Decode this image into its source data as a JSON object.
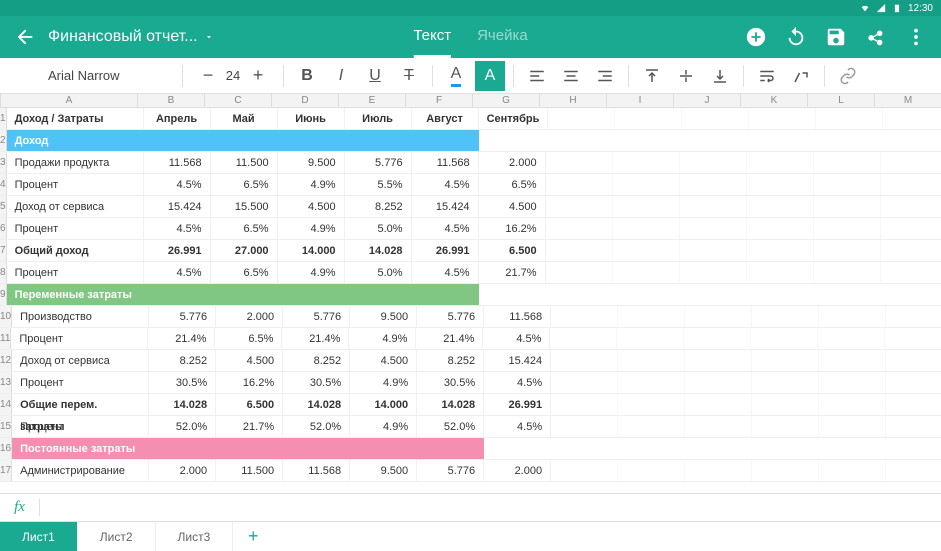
{
  "status": {
    "time": "12:30"
  },
  "header": {
    "title": "Финансовый отчет...",
    "tabs": [
      "Текст",
      "Ячейка"
    ],
    "active_tab": 0
  },
  "toolbar": {
    "font": "Arial Narrow",
    "font_size": "24"
  },
  "columns": [
    "A",
    "B",
    "C",
    "D",
    "E",
    "F",
    "G",
    "H",
    "I",
    "J",
    "K",
    "L",
    "M"
  ],
  "data_cols": 6,
  "rows": [
    {
      "n": 1,
      "type": "hdr",
      "cells": [
        "Доход / Затраты",
        "Апрель",
        "Май",
        "Июнь",
        "Июль",
        "Август",
        "Сентябрь"
      ]
    },
    {
      "n": 2,
      "type": "sect blue",
      "cells": [
        "Доход",
        "",
        "",
        "",
        "",
        "",
        ""
      ]
    },
    {
      "n": 3,
      "type": "",
      "cells": [
        "Продажи продукта",
        "11.568",
        "11.500",
        "9.500",
        "5.776",
        "11.568",
        "2.000"
      ]
    },
    {
      "n": 4,
      "type": "",
      "cells": [
        "Процент",
        "4.5%",
        "6.5%",
        "4.9%",
        "5.5%",
        "4.5%",
        "6.5%"
      ]
    },
    {
      "n": 5,
      "type": "",
      "cells": [
        "Доход от сервиса",
        "15.424",
        "15.500",
        "4.500",
        "8.252",
        "15.424",
        "4.500"
      ]
    },
    {
      "n": 6,
      "type": "",
      "cells": [
        "Процент",
        "4.5%",
        "6.5%",
        "4.9%",
        "5.0%",
        "4.5%",
        "16.2%"
      ]
    },
    {
      "n": 7,
      "type": "bold",
      "cells": [
        "Общий доход",
        "26.991",
        "27.000",
        "14.000",
        "14.028",
        "26.991",
        "6.500"
      ]
    },
    {
      "n": 8,
      "type": "",
      "cells": [
        "Процент",
        "4.5%",
        "6.5%",
        "4.9%",
        "5.0%",
        "4.5%",
        "21.7%"
      ]
    },
    {
      "n": 9,
      "type": "sect green",
      "cells": [
        "Переменные затраты",
        "",
        "",
        "",
        "",
        "",
        ""
      ]
    },
    {
      "n": 10,
      "type": "",
      "cells": [
        "Производство",
        "5.776",
        "2.000",
        "5.776",
        "9.500",
        "5.776",
        "11.568"
      ]
    },
    {
      "n": 11,
      "type": "",
      "cells": [
        "Процент",
        "21.4%",
        "6.5%",
        "21.4%",
        "4.9%",
        "21.4%",
        "4.5%"
      ]
    },
    {
      "n": 12,
      "type": "",
      "cells": [
        "Доход от сервиса",
        "8.252",
        "4.500",
        "8.252",
        "4.500",
        "8.252",
        "15.424"
      ]
    },
    {
      "n": 13,
      "type": "",
      "cells": [
        "Процент",
        "30.5%",
        "16.2%",
        "30.5%",
        "4.9%",
        "30.5%",
        "4.5%"
      ]
    },
    {
      "n": 14,
      "type": "bold",
      "cells": [
        "Общие перем. затраты",
        "14.028",
        "6.500",
        "14.028",
        "14.000",
        "14.028",
        "26.991"
      ]
    },
    {
      "n": 15,
      "type": "",
      "cells": [
        "Процент",
        "52.0%",
        "21.7%",
        "52.0%",
        "4.9%",
        "52.0%",
        "4.5%"
      ]
    },
    {
      "n": 16,
      "type": "sect pink",
      "cells": [
        "Постоянные затраты",
        "",
        "",
        "",
        "",
        "",
        ""
      ]
    },
    {
      "n": 17,
      "type": "",
      "cells": [
        "Администрирование",
        "2.000",
        "11.500",
        "11.568",
        "9.500",
        "5.776",
        "2.000"
      ]
    }
  ],
  "sheets": [
    "Лист1",
    "Лист2",
    "Лист3"
  ],
  "active_sheet": 0
}
